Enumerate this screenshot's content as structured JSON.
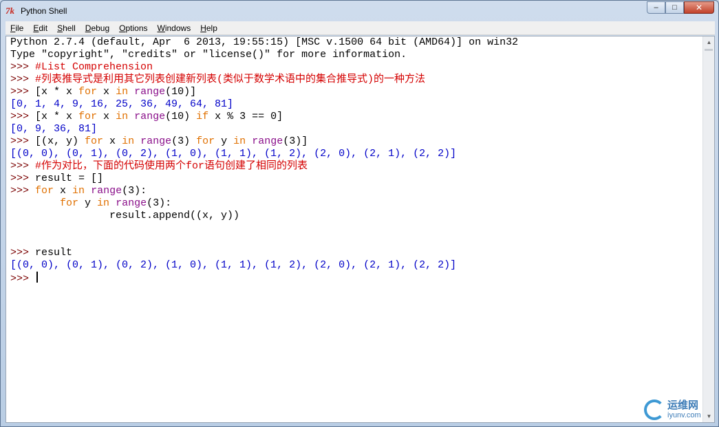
{
  "window": {
    "title": "Python Shell",
    "icon": "tk-feather-icon",
    "controls": {
      "minimize": "‒",
      "maximize": "□",
      "close": "✕"
    }
  },
  "menu": [
    {
      "accel": "F",
      "rest": "ile"
    },
    {
      "accel": "E",
      "rest": "dit"
    },
    {
      "accel": "S",
      "rest": "hell"
    },
    {
      "accel": "D",
      "rest": "ebug"
    },
    {
      "accel": "O",
      "rest": "ptions"
    },
    {
      "accel": "W",
      "rest": "indows"
    },
    {
      "accel": "H",
      "rest": "elp"
    }
  ],
  "colors": {
    "prompt": "#7a0000",
    "output": "#0000c8",
    "keyword": "#e07000",
    "builtin": "#8a0f8a",
    "comment": "#d40000"
  },
  "shell": {
    "lines": [
      [
        {
          "t": "Python 2.7.4 (default, Apr  6 2013, 19:55:15) [MSC v.1500 64 bit (AMD64)] on win32",
          "c": "text"
        }
      ],
      [
        {
          "t": "Type \"copyright\", \"credits\" or \"license()\" for more information.",
          "c": "text"
        }
      ],
      [
        {
          "t": ">>> ",
          "c": "prompt"
        },
        {
          "t": "#List Comprehension",
          "c": "comment"
        }
      ],
      [
        {
          "t": ">>> ",
          "c": "prompt"
        },
        {
          "t": "#列表推导式是利用其它列表创建新列表(类似于数学术语中的集合推导式)的一种方法",
          "c": "comment"
        }
      ],
      [
        {
          "t": ">>> ",
          "c": "prompt"
        },
        {
          "t": "[x * x ",
          "c": "text"
        },
        {
          "t": "for",
          "c": "keyword"
        },
        {
          "t": " x ",
          "c": "text"
        },
        {
          "t": "in",
          "c": "keyword"
        },
        {
          "t": " ",
          "c": "text"
        },
        {
          "t": "range",
          "c": "builtin"
        },
        {
          "t": "(10)]",
          "c": "text"
        }
      ],
      [
        {
          "t": "[0, 1, 4, 9, 16, 25, 36, 49, 64, 81]",
          "c": "output"
        }
      ],
      [
        {
          "t": ">>> ",
          "c": "prompt"
        },
        {
          "t": "[x * x ",
          "c": "text"
        },
        {
          "t": "for",
          "c": "keyword"
        },
        {
          "t": " x ",
          "c": "text"
        },
        {
          "t": "in",
          "c": "keyword"
        },
        {
          "t": " ",
          "c": "text"
        },
        {
          "t": "range",
          "c": "builtin"
        },
        {
          "t": "(10) ",
          "c": "text"
        },
        {
          "t": "if",
          "c": "keyword"
        },
        {
          "t": " x % 3 == 0]",
          "c": "text"
        }
      ],
      [
        {
          "t": "[0, 9, 36, 81]",
          "c": "output"
        }
      ],
      [
        {
          "t": ">>> ",
          "c": "prompt"
        },
        {
          "t": "[(x, y) ",
          "c": "text"
        },
        {
          "t": "for",
          "c": "keyword"
        },
        {
          "t": " x ",
          "c": "text"
        },
        {
          "t": "in",
          "c": "keyword"
        },
        {
          "t": " ",
          "c": "text"
        },
        {
          "t": "range",
          "c": "builtin"
        },
        {
          "t": "(3) ",
          "c": "text"
        },
        {
          "t": "for",
          "c": "keyword"
        },
        {
          "t": " y ",
          "c": "text"
        },
        {
          "t": "in",
          "c": "keyword"
        },
        {
          "t": " ",
          "c": "text"
        },
        {
          "t": "range",
          "c": "builtin"
        },
        {
          "t": "(3)]",
          "c": "text"
        }
      ],
      [
        {
          "t": "[(0, 0), (0, 1), (0, 2), (1, 0), (1, 1), (1, 2), (2, 0), (2, 1), (2, 2)]",
          "c": "output"
        }
      ],
      [
        {
          "t": ">>> ",
          "c": "prompt"
        },
        {
          "t": "#作为对比，下面的代码使用两个for语句创建了相同的列表",
          "c": "comment"
        }
      ],
      [
        {
          "t": ">>> ",
          "c": "prompt"
        },
        {
          "t": "result = []",
          "c": "text"
        }
      ],
      [
        {
          "t": ">>> ",
          "c": "prompt"
        },
        {
          "t": "for",
          "c": "keyword"
        },
        {
          "t": " x ",
          "c": "text"
        },
        {
          "t": "in",
          "c": "keyword"
        },
        {
          "t": " ",
          "c": "text"
        },
        {
          "t": "range",
          "c": "builtin"
        },
        {
          "t": "(3):",
          "c": "text"
        }
      ],
      [
        {
          "t": "\tfor",
          "c": "keyword"
        },
        {
          "t": " y ",
          "c": "text"
        },
        {
          "t": "in",
          "c": "keyword"
        },
        {
          "t": " ",
          "c": "text"
        },
        {
          "t": "range",
          "c": "builtin"
        },
        {
          "t": "(3):",
          "c": "text"
        }
      ],
      [
        {
          "t": "\t\tresult.append((x, y))",
          "c": "text"
        }
      ],
      [],
      [],
      [
        {
          "t": ">>> ",
          "c": "prompt"
        },
        {
          "t": "result",
          "c": "text"
        }
      ],
      [
        {
          "t": "[(0, 0), (0, 1), (0, 2), (1, 0), (1, 1), (1, 2), (2, 0), (2, 1), (2, 2)]",
          "c": "output"
        }
      ],
      [
        {
          "t": ">>> ",
          "c": "prompt"
        },
        {
          "cursor": true
        }
      ]
    ]
  },
  "watermark": {
    "cn": "运维网",
    "en": "iyunv.com"
  }
}
